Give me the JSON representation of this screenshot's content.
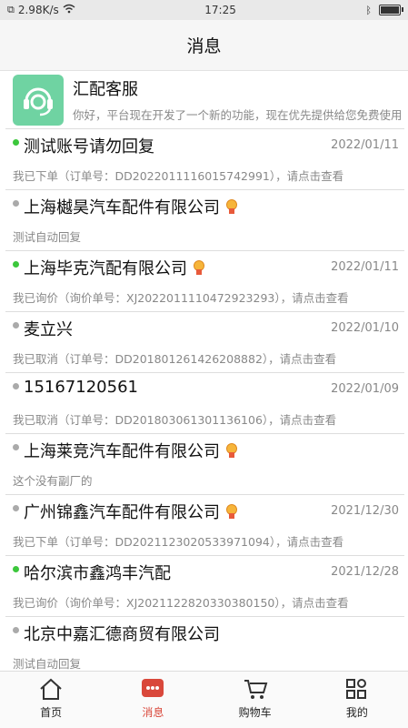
{
  "status_bar": {
    "speed": "2.98K/s",
    "time": "17:25"
  },
  "header": {
    "title": "消息"
  },
  "service": {
    "name": "汇配客服",
    "message": "你好，平台现在开发了一个新的功能，现在优先提供给您免费使用"
  },
  "conversations": [
    {
      "name": "测试账号请勿回复",
      "date": "2022/01/11",
      "message": "我已下单（订单号：DD2022011116015742991），请点击查看",
      "online": true,
      "medal": false
    },
    {
      "name": "上海樾昊汽车配件有限公司",
      "date": "",
      "message": "测试自动回复",
      "online": false,
      "medal": true
    },
    {
      "name": "上海毕克汽配有限公司",
      "date": "2022/01/11",
      "message": "我已询价（询价单号：XJ2022011110472923293），请点击查看",
      "online": true,
      "medal": true
    },
    {
      "name": "麦立兴",
      "date": "2022/01/10",
      "message": "我已取消（订单号：DD2018012614262088​82），请点击查看",
      "online": false,
      "medal": false
    },
    {
      "name": "15167120561",
      "date": "2022/01/09",
      "message": "我已取消（订单号：DD2018030613011361​06），请点击查看",
      "online": false,
      "medal": false
    },
    {
      "name": "上海莱竞汽车配件有限公司",
      "date": "",
      "message": "这个没有副厂的",
      "online": false,
      "medal": true
    },
    {
      "name": "广州锦鑫汽车配件有限公司",
      "date": "2021/12/30",
      "message": "我已下单（订单号：DD2021123020533971094），请点击查看",
      "online": false,
      "medal": true
    },
    {
      "name": "哈尔滨市鑫鸿丰汽配",
      "date": "2021/12/28",
      "message": "我已询价（询价单号：XJ2021122820330380150），请点击查看",
      "online": true,
      "medal": false
    },
    {
      "name": "北京中嘉汇德商贸有限公司",
      "date": "",
      "message": "测试自动回复",
      "online": false,
      "medal": false
    }
  ],
  "tabs": [
    {
      "label": "首页",
      "icon": "home-icon",
      "active": false
    },
    {
      "label": "消息",
      "icon": "message-icon",
      "active": true
    },
    {
      "label": "购物车",
      "icon": "cart-icon",
      "active": false
    },
    {
      "label": "我的",
      "icon": "profile-icon",
      "active": false
    }
  ],
  "colors": {
    "accent": "#d9483b",
    "online": "#3cc73c",
    "service_avatar": "#6fd3a2"
  }
}
